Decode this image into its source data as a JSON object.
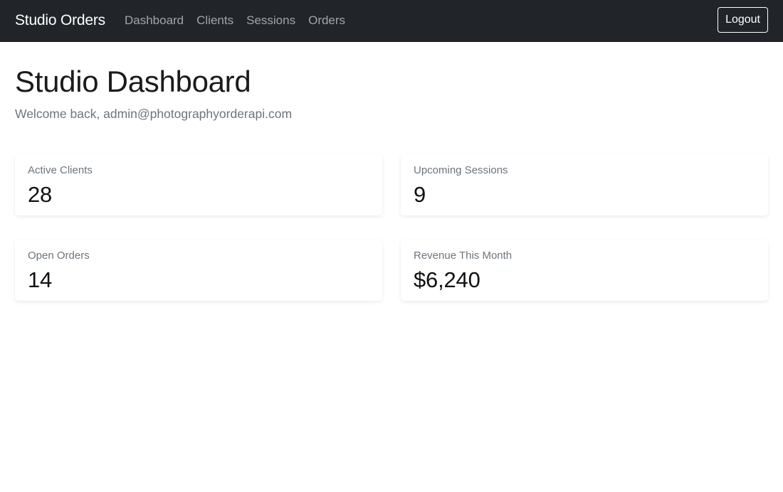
{
  "navbar": {
    "brand": "Studio Orders",
    "links": [
      {
        "label": "Dashboard"
      },
      {
        "label": "Clients"
      },
      {
        "label": "Sessions"
      },
      {
        "label": "Orders"
      }
    ],
    "logout_label": "Logout"
  },
  "page": {
    "title": "Studio Dashboard",
    "welcome": "Welcome back, admin@photographyorderapi.com"
  },
  "stats": [
    {
      "label": "Active Clients",
      "value": "28"
    },
    {
      "label": "Upcoming Sessions",
      "value": "9"
    },
    {
      "label": "Open Orders",
      "value": "14"
    },
    {
      "label": "Revenue This Month",
      "value": "$6,240"
    }
  ]
}
